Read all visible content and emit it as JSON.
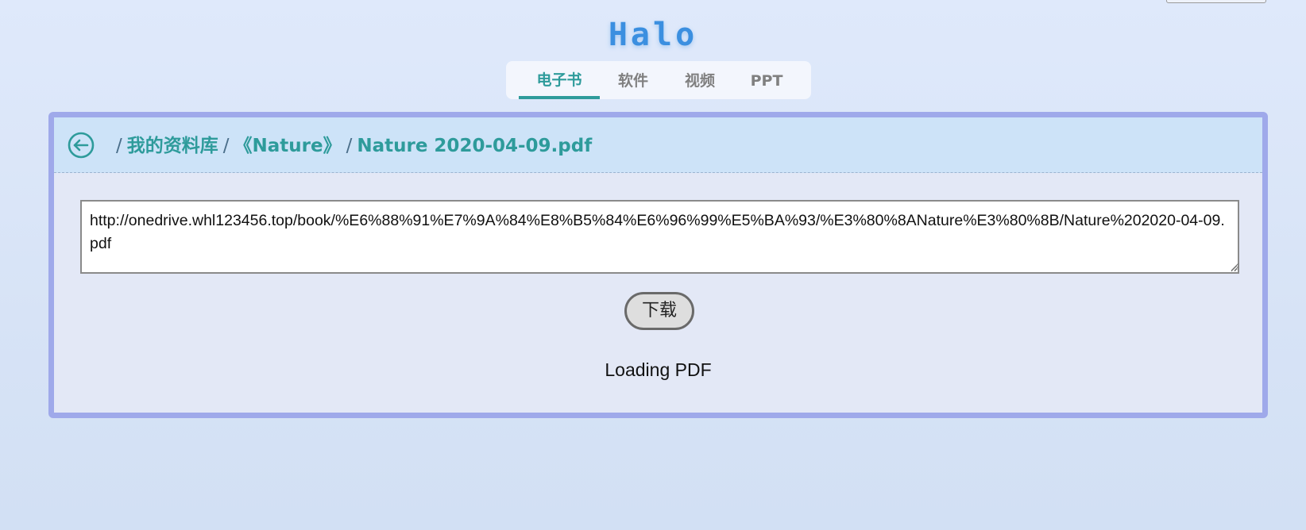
{
  "site": {
    "title": "Halo"
  },
  "tabs": [
    {
      "label": "电子书",
      "active": true
    },
    {
      "label": "软件",
      "active": false
    },
    {
      "label": "视频",
      "active": false
    },
    {
      "label": "PPT",
      "active": false
    }
  ],
  "breadcrumb": {
    "back_icon": "arrow-left-circle-icon",
    "items": [
      {
        "label": "我的资料库"
      },
      {
        "label": "《Nature》"
      },
      {
        "label": "Nature 2020-04-09.pdf"
      }
    ],
    "separator": "/"
  },
  "url_field": {
    "value": "http://onedrive.whl123456.top/book/%E6%88%91%E7%9A%84%E8%B5%84%E6%96%99%E5%BA%93/%E3%80%8ANature%E3%80%8B/Nature%202020-04-09.pdf"
  },
  "download_button": {
    "label": "下载"
  },
  "status": {
    "loading_text": "Loading PDF"
  },
  "colors": {
    "accent": "#2e9b9b",
    "title": "#3b8fe0",
    "panel_border": "#9fa9ea",
    "header_bg": "#cde3f8"
  }
}
